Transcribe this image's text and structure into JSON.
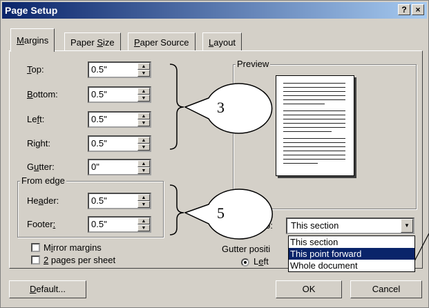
{
  "window": {
    "title": "Page Setup",
    "help_label": "?",
    "close_label": "×"
  },
  "tabs": [
    {
      "pre": "",
      "u": "M",
      "post": "argins"
    },
    {
      "pre": "Paper ",
      "u": "S",
      "post": "ize"
    },
    {
      "pre": "",
      "u": "P",
      "post": "aper Source"
    },
    {
      "pre": "",
      "u": "L",
      "post": "ayout"
    }
  ],
  "margins": {
    "top": {
      "pre": "",
      "u": "T",
      "post": "op:",
      "value": "0.5\""
    },
    "bottom": {
      "pre": "",
      "u": "B",
      "post": "ottom:",
      "value": "0.5\""
    },
    "left": {
      "pre": "Le",
      "u": "f",
      "post": "t:",
      "value": "0.5\""
    },
    "right": {
      "pre": "Ri",
      "u": "g",
      "post": "ht:",
      "value": "0.5\""
    },
    "gutter": {
      "pre": "G",
      "u": "u",
      "post": "tter:",
      "value": "0\""
    }
  },
  "from_edge": {
    "title": "From edge",
    "header": {
      "pre": "He",
      "u": "a",
      "post": "der:",
      "value": "0.5\""
    },
    "footer": {
      "pre": "Footer",
      "u": ":",
      "post": "",
      "value": "0.5\""
    }
  },
  "preview": {
    "title": "Preview"
  },
  "apply_to": {
    "label": "o:",
    "value": "This section",
    "options": [
      "This section",
      "This point forward",
      "Whole document"
    ],
    "highlighted": "This point forward"
  },
  "gutter_position": {
    "label": "Gutter positi",
    "option_pre": "L",
    "option_u": "e",
    "option_post": "ft"
  },
  "checkboxes": {
    "mirror": {
      "pre": "M",
      "u": "i",
      "post": "rror margins",
      "checked": false
    },
    "two_pages": {
      "pre": "",
      "u": "2",
      "post": " pages per sheet",
      "checked": false
    }
  },
  "buttons": {
    "default_pre": "",
    "default_u": "D",
    "default_post": "efault...",
    "ok": "OK",
    "cancel": "Cancel"
  },
  "callouts": {
    "first": "3",
    "second": "5"
  }
}
